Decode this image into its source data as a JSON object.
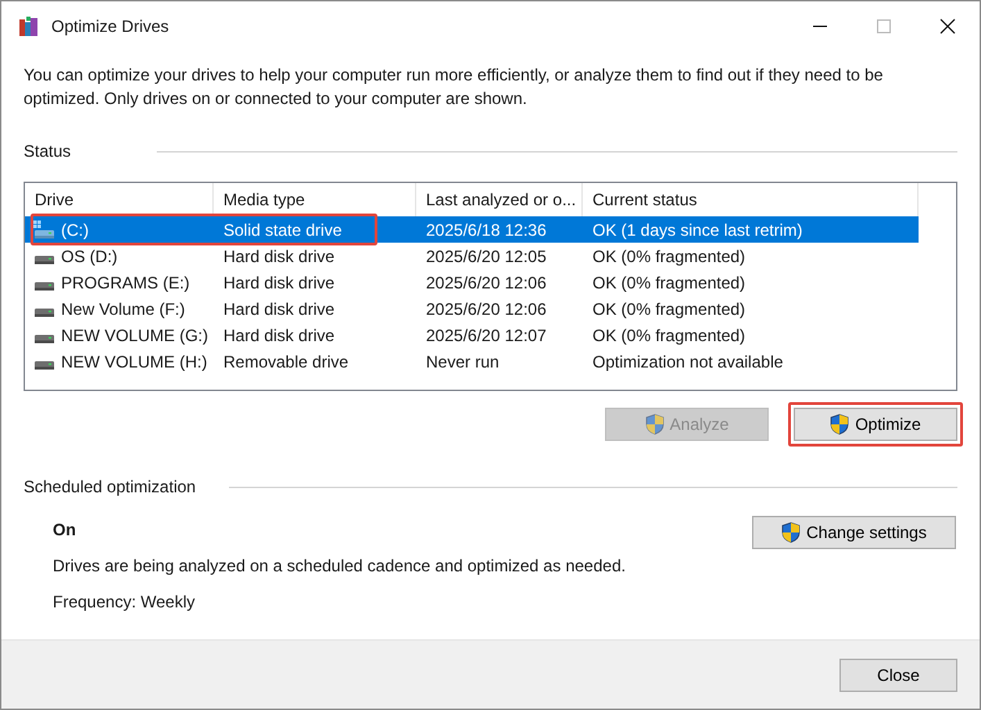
{
  "window": {
    "title": "Optimize Drives"
  },
  "description": "You can optimize your drives to help your computer run more efficiently, or analyze them to find out if they need to be optimized. Only drives on or connected to your computer are shown.",
  "status": {
    "heading": "Status",
    "columns": [
      "Drive",
      "Media type",
      "Last analyzed or o...",
      "Current status"
    ],
    "rows": [
      {
        "drive": "(C:)",
        "kind": "system",
        "media": "Solid state drive",
        "last": "2025/6/18 12:36",
        "status": "OK (1 days since last retrim)",
        "selected": true,
        "highlighted": true
      },
      {
        "drive": "OS (D:)",
        "kind": "disk",
        "media": "Hard disk drive",
        "last": "2025/6/20 12:05",
        "status": "OK (0% fragmented)",
        "selected": false,
        "highlighted": false
      },
      {
        "drive": "PROGRAMS (E:)",
        "kind": "disk",
        "media": "Hard disk drive",
        "last": "2025/6/20 12:06",
        "status": "OK (0% fragmented)",
        "selected": false,
        "highlighted": false
      },
      {
        "drive": "New Volume (F:)",
        "kind": "disk",
        "media": "Hard disk drive",
        "last": "2025/6/20 12:06",
        "status": "OK (0% fragmented)",
        "selected": false,
        "highlighted": false
      },
      {
        "drive": "NEW VOLUME (G:)",
        "kind": "disk",
        "media": "Hard disk drive",
        "last": "2025/6/20 12:07",
        "status": "OK (0% fragmented)",
        "selected": false,
        "highlighted": false
      },
      {
        "drive": "NEW VOLUME (H:)",
        "kind": "disk",
        "media": "Removable drive",
        "last": "Never run",
        "status": "Optimization not available",
        "selected": false,
        "highlighted": false
      }
    ],
    "buttons": [
      {
        "label": "Analyze",
        "disabled": true,
        "highlighted": false
      },
      {
        "label": "Optimize",
        "disabled": false,
        "highlighted": true
      }
    ]
  },
  "scheduled": {
    "heading": "Scheduled optimization",
    "state": "On",
    "note": "Drives are being analyzed on a scheduled cadence and optimized as needed.",
    "frequency": "Frequency: Weekly",
    "button": "Change settings"
  },
  "footer": {
    "button": "Close"
  }
}
